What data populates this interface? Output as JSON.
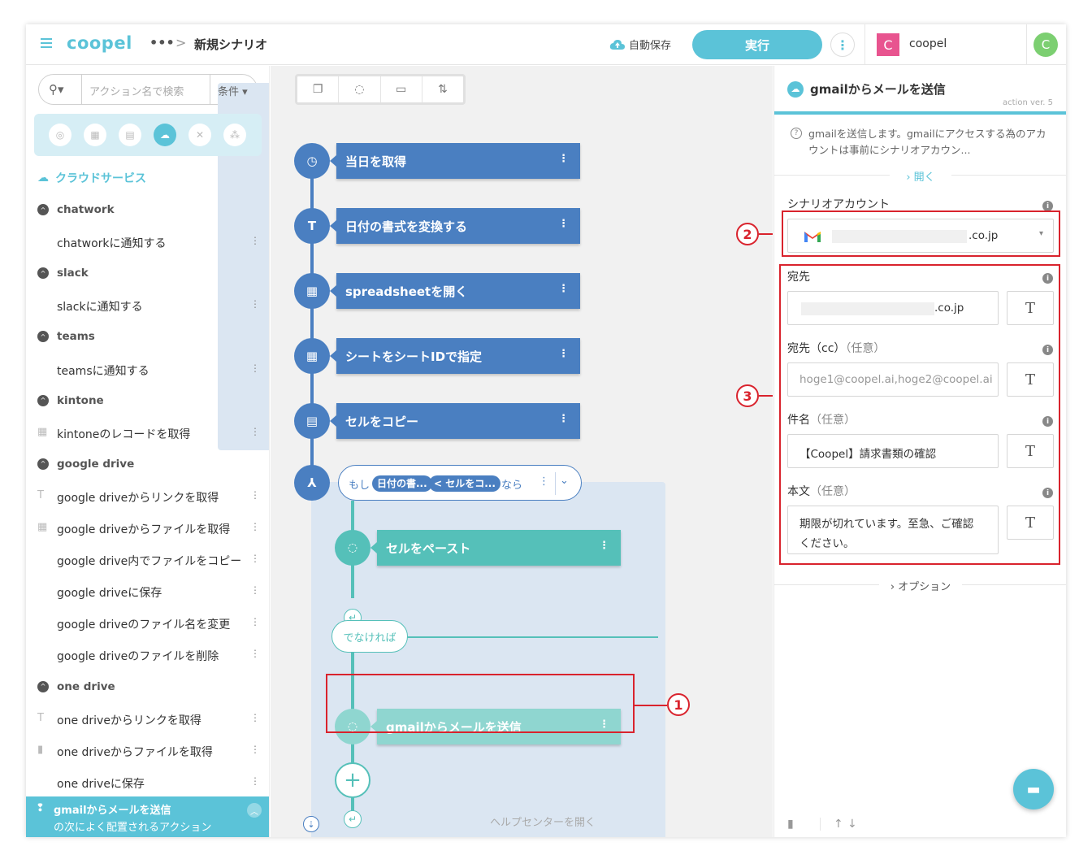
{
  "header": {
    "logo": "coopel",
    "more": "•••",
    "separator": ">",
    "title": "新規シナリオ",
    "autosave_label": "自動保存",
    "run_label": "実行",
    "kebab": "⋮",
    "account_initial": "C",
    "account_name": "coopel",
    "user_initial": "C"
  },
  "sidebar": {
    "search_placeholder": "アクション名で検索",
    "condition_label": "条件",
    "section_title": "クラウドサービス",
    "items": [
      {
        "type": "group",
        "label": "chatwork"
      },
      {
        "type": "item",
        "label": "chatworkに通知する",
        "icon": ""
      },
      {
        "type": "group",
        "label": "slack"
      },
      {
        "type": "item",
        "label": "slackに通知する",
        "icon": ""
      },
      {
        "type": "group",
        "label": "teams"
      },
      {
        "type": "item",
        "label": "teamsに通知する",
        "icon": ""
      },
      {
        "type": "group",
        "label": "kintone"
      },
      {
        "type": "item",
        "label": "kintoneのレコードを取得",
        "icon": "grid"
      },
      {
        "type": "group",
        "label": "google drive"
      },
      {
        "type": "item",
        "label": "google driveからリンクを取得",
        "icon": "T"
      },
      {
        "type": "item",
        "label": "google driveからファイルを取得",
        "icon": "grid"
      },
      {
        "type": "item",
        "label": "google drive内でファイルをコピー",
        "icon": ""
      },
      {
        "type": "item",
        "label": "google driveに保存",
        "icon": ""
      },
      {
        "type": "item",
        "label": "google driveのファイル名を変更",
        "icon": ""
      },
      {
        "type": "item",
        "label": "google driveのファイルを削除",
        "icon": ""
      },
      {
        "type": "group",
        "label": "one drive"
      },
      {
        "type": "item",
        "label": "one driveからリンクを取得",
        "icon": "T"
      },
      {
        "type": "item",
        "label": "one driveからファイルを取得",
        "icon": "file"
      },
      {
        "type": "item",
        "label": "one driveに保存",
        "icon": ""
      }
    ],
    "footer_title": "gmailからメールを送信",
    "footer_subtitle": "の次によく配置されるアクション"
  },
  "flow": {
    "steps": [
      {
        "label": "当日を取得",
        "icon": "clock-icon",
        "glyph": "◷"
      },
      {
        "label": "日付の書式を変換する",
        "icon": "text-icon",
        "glyph": "T"
      },
      {
        "label": "spreadsheetを開く",
        "icon": "table-icon",
        "glyph": "▦"
      },
      {
        "label": "シートをシートIDで指定",
        "icon": "table-icon",
        "glyph": "▦"
      },
      {
        "label": "セルをコピー",
        "icon": "cells-icon",
        "glyph": "▤"
      }
    ],
    "condition": {
      "prefix": "もし",
      "chip1": "日付の書...",
      "chip2": "< セルをコ...",
      "suffix": "なら"
    },
    "then_step": "セルをペースト",
    "else_label": "でなければ",
    "else_step": "gmailからメールを送信",
    "help_link": "ヘルプセンターを開く"
  },
  "annotations": {
    "badge1": "1",
    "badge2": "2",
    "badge3": "3"
  },
  "panel": {
    "title": "gmailからメールを送信",
    "version": "action ver. 5",
    "description": "gmailを送信します。gmailにアクセスする為のアカウントは事前にシナリオアカウン...",
    "open_label": "開く",
    "account_label": "シナリオアカウント",
    "account_value": ".co.jp",
    "to_label": "宛先",
    "to_value": ".co.jp",
    "cc_label": "宛先（cc）",
    "cc_optional": "（任意）",
    "cc_placeholder": "hoge1@coopel.ai,hoge2@coopel.ai",
    "subject_label": "件名",
    "subject_optional": "（任意）",
    "subject_value": "【Coopel】請求書類の確認",
    "body_label": "本文",
    "body_optional": "（任意）",
    "body_value_1": "期限が切れています。至急、ご確認",
    "body_value_2": "ください。",
    "text_button": "T",
    "options_label": "オプション"
  },
  "colors": {
    "accent": "#5bc3d8",
    "flow_blue": "#4a7fc1",
    "flow_teal": "#55c0b9",
    "annotation_red": "#d9232d"
  }
}
